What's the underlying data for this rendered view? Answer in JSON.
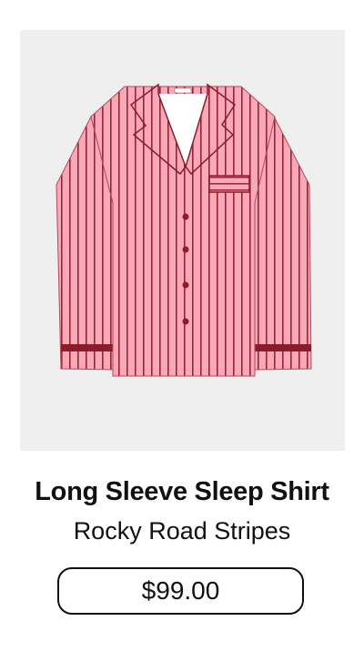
{
  "product": {
    "name": "Long Sleeve Sleep Shirt",
    "variant": "Rocky Road Stripes",
    "price": "$99.00",
    "image_icon": "striped-pajama-shirt-image",
    "colors": {
      "background": "#efefef",
      "shirt": "#f7a9b8",
      "stripe": "#9b2136",
      "button": "#8a1c2b"
    }
  }
}
